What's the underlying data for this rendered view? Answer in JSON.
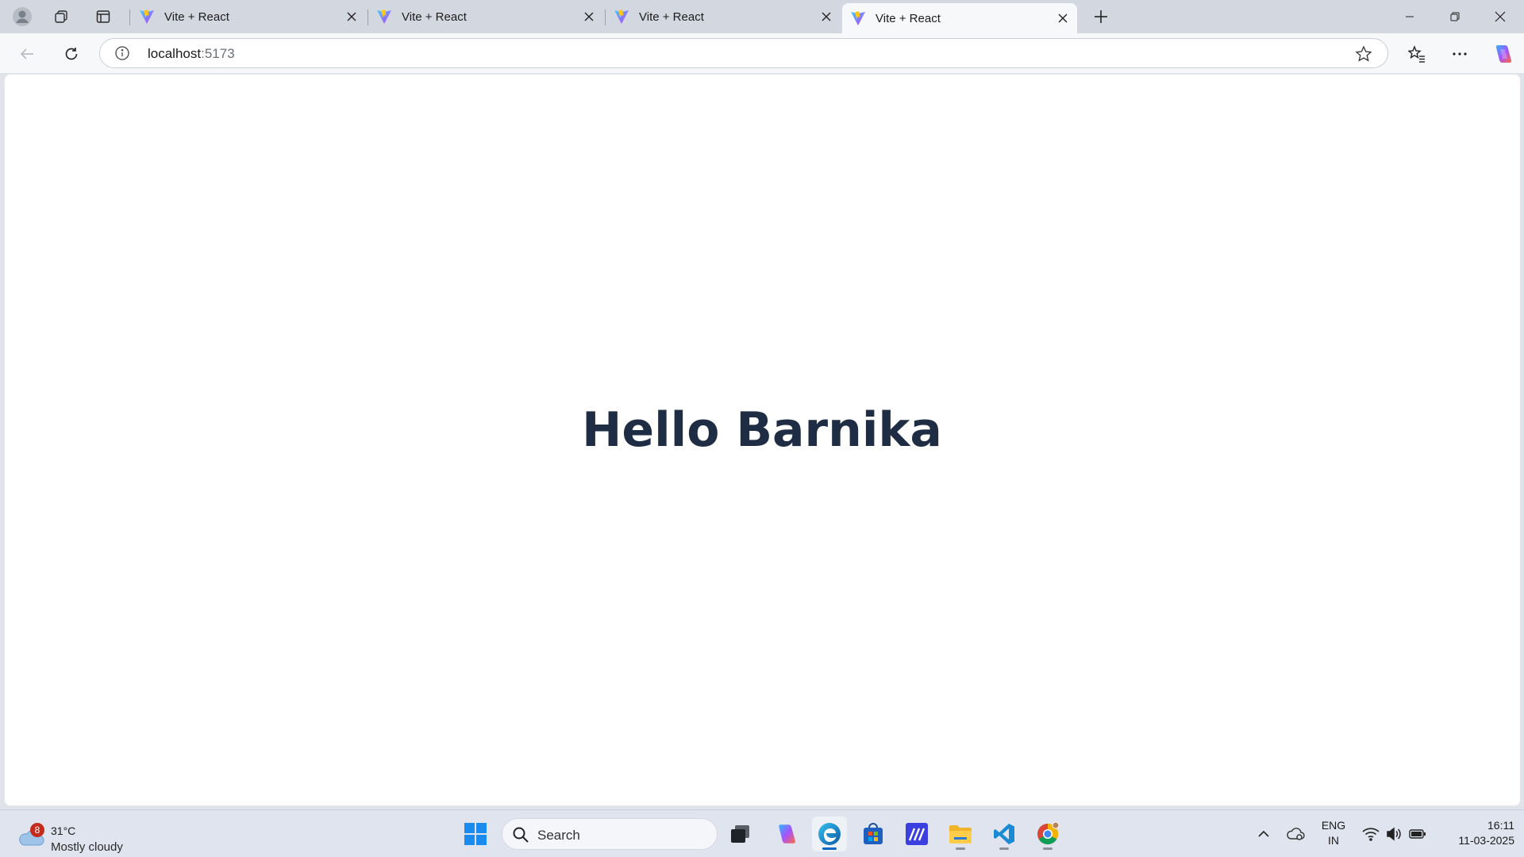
{
  "browser": {
    "tabs": [
      {
        "title": "Vite + React",
        "active": false
      },
      {
        "title": "Vite + React",
        "active": false
      },
      {
        "title": "Vite + React",
        "active": false
      },
      {
        "title": "Vite + React",
        "active": true
      }
    ],
    "address_bar": {
      "host": "localhost",
      "port": ":5173"
    }
  },
  "page": {
    "heading": "Hello Barnika"
  },
  "taskbar": {
    "weather": {
      "badge": "8",
      "temperature": "31°C",
      "condition": "Mostly cloudy"
    },
    "search": {
      "label": "Search"
    },
    "language": {
      "line1": "ENG",
      "line2": "IN"
    },
    "clock": {
      "time": "16:11",
      "date": "11-03-2025"
    }
  },
  "icons": {
    "profile": "profile-icon",
    "workspaces": "workspaces-icon",
    "tab_actions": "vertical-tabs-icon",
    "favicon": "vite-logo-icon",
    "close": "close-icon",
    "new_tab": "plus-icon",
    "back": "back-arrow-icon",
    "refresh": "refresh-icon",
    "info": "info-icon",
    "favorite": "star-icon",
    "favorites": "favorites-icon",
    "more": "more-icon",
    "copilot": "copilot-icon"
  },
  "colors": {
    "heading": "#1f2d44",
    "accent": "#0067c0"
  }
}
